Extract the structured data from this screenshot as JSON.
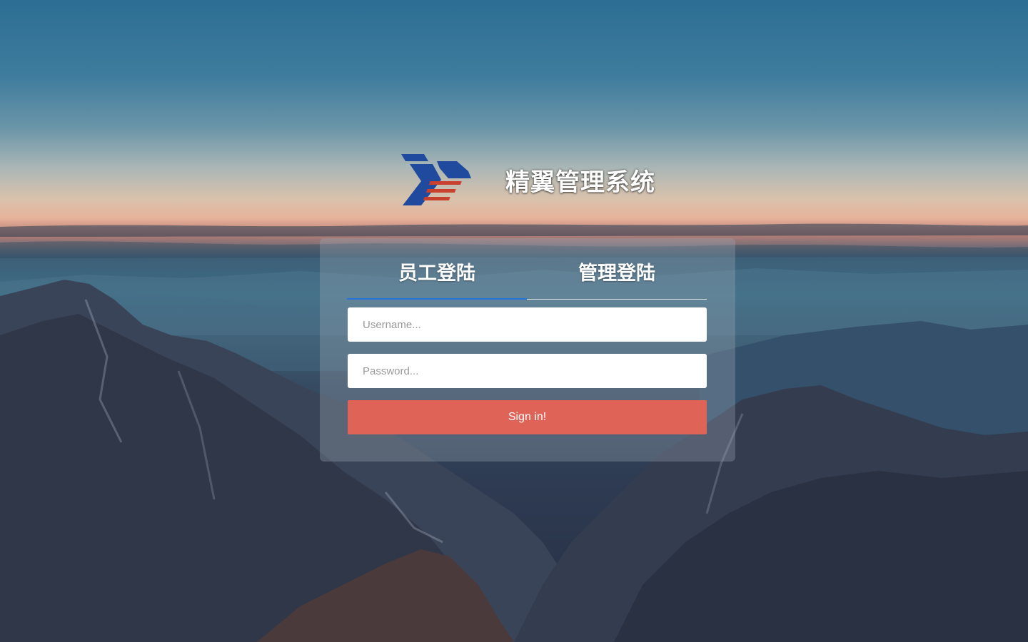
{
  "app": {
    "title": "精翼管理系统",
    "logo": "jingyi-logo"
  },
  "tabs": [
    {
      "label": "员工登陆",
      "active": true
    },
    {
      "label": "管理登陆",
      "active": false
    }
  ],
  "form": {
    "username_placeholder": "Username...",
    "username_value": "",
    "password_placeholder": "Password...",
    "password_value": "",
    "submit_label": "Sign in!"
  },
  "colors": {
    "accent_tab_underline": "#2a73d6",
    "submit_button": "#df6356",
    "logo_blue": "#1f4a9e",
    "logo_red": "#c8412e"
  }
}
